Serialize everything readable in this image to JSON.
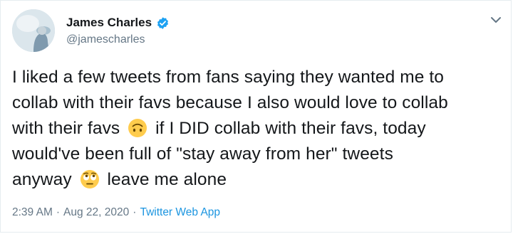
{
  "author": {
    "display_name": "James Charles",
    "handle": "@jamescharles",
    "verified": true
  },
  "tweet": {
    "lines": [
      {
        "parts": [
          "I liked a few tweets from fans saying they wanted me to"
        ]
      },
      {
        "parts": [
          "collab with their favs because I also would love to collab"
        ]
      },
      {
        "parts": [
          "with their favs",
          "if I DID collab with their favs, today"
        ],
        "emoji": "upside-down-face-emoji"
      },
      {
        "parts": [
          "would've been full of \"stay away from her\" tweets"
        ]
      },
      {
        "parts": [
          "anyway",
          "leave me alone"
        ],
        "emoji": "face-with-rolling-eyes-emoji"
      }
    ]
  },
  "meta": {
    "time": "2:39 AM",
    "separator": "·",
    "date": "Aug 22, 2020",
    "source": "Twitter Web App"
  },
  "colors": {
    "text": "#14171a",
    "muted": "#657786",
    "accent": "#1da1f2",
    "border": "#e6ecf0"
  },
  "icons": [
    "verified-badge-icon",
    "chevron-down-icon",
    "upside-down-face-emoji",
    "face-with-rolling-eyes-emoji"
  ]
}
